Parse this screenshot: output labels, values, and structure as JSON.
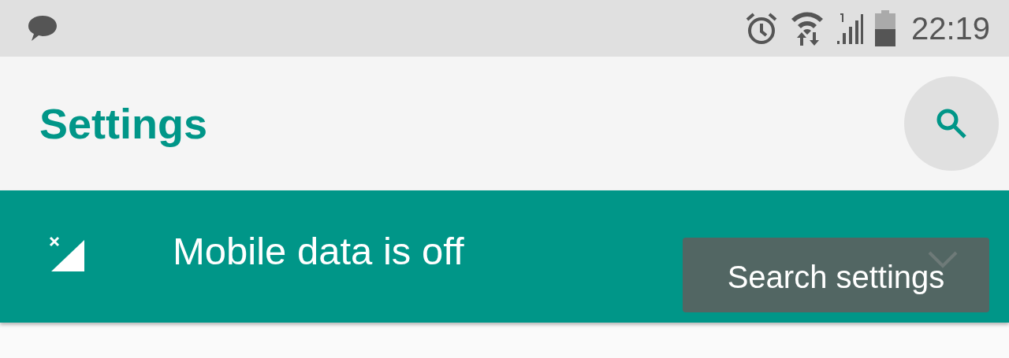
{
  "status_bar": {
    "time": "22:19"
  },
  "toolbar": {
    "title": "Settings"
  },
  "banner": {
    "text": "Mobile data is off"
  },
  "tooltip": {
    "text": "Search settings"
  }
}
